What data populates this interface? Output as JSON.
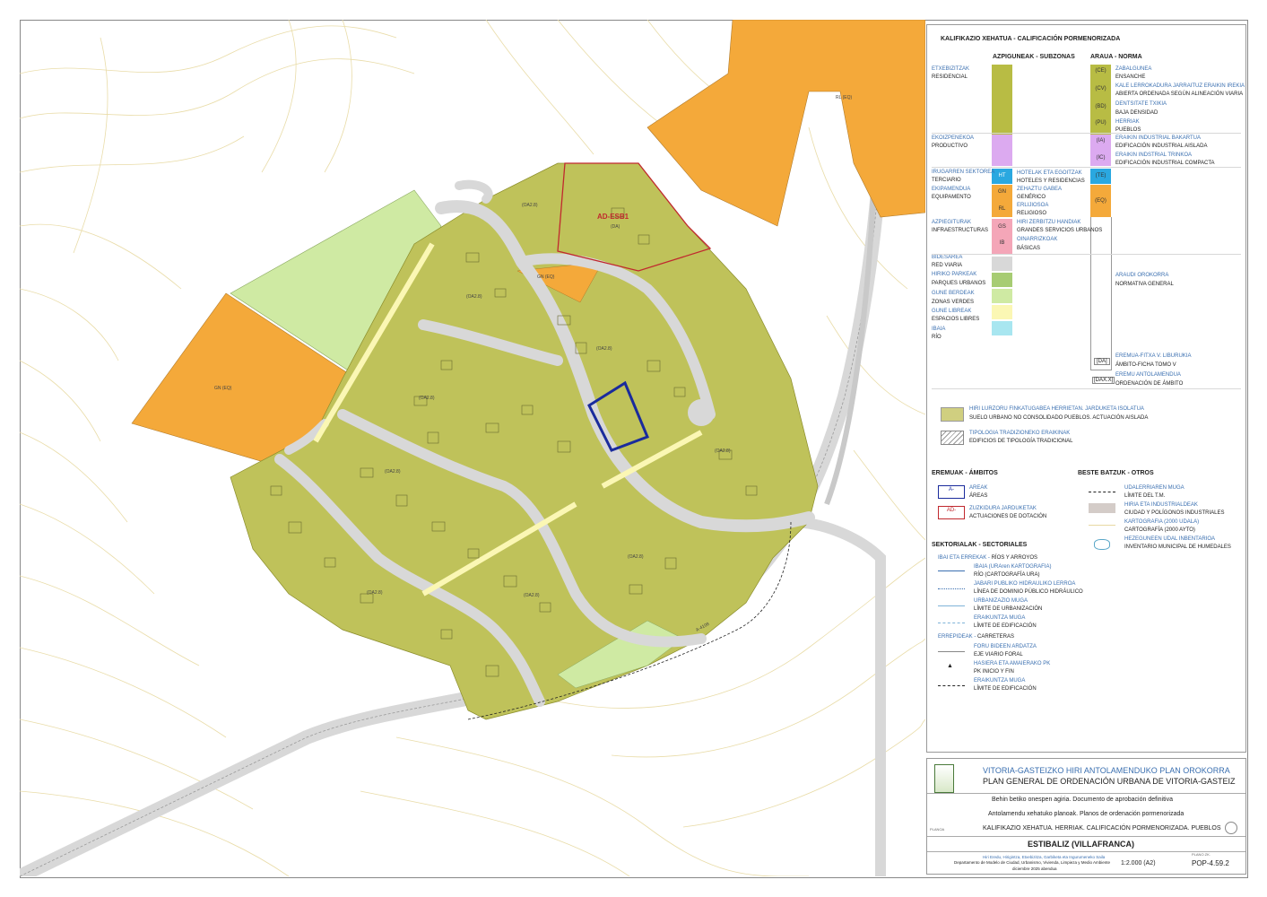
{
  "legend": {
    "title_eu": "KALIFIKAZIO XEHATUA - ",
    "title_es": "CALIFICACIÓN PORMENORIZADA",
    "col_subzones_eu": "AZPIGUNEAK - ",
    "col_subzones_es": "SUBZONAS",
    "col_norm_eu": "ARAUA - ",
    "col_norm_es": "NORMA",
    "residential_eu": "ETXEBIZITZAK",
    "residential_es": "RESIDENCIAL",
    "ce_eu": "ZABALGUNEA",
    "ce_es": "ENSANCHE",
    "cv_eu": "KALE LERROKADURA JARRAITUZ ERAIKIN IREKIA",
    "cv_es": "ABIERTA ORDENADA SEGÚN ALINEACIÓN VIARIA",
    "bd_eu": "DENTSITATE TXIKIA",
    "bd_es": "BAJA DENSIDAD",
    "pu_eu": "HERRIAK",
    "pu_es": "PUEBLOS",
    "productive_eu": "EKOIZPENEKOA",
    "productive_es": "PRODUCTIVO",
    "ia_eu": "ERAIKIN INDUSTRIAL BAKARTUA",
    "ia_es": "EDIFICACIÓN INDUSTRIAL AISLADA",
    "ic_eu": "ERAIKIN INDSTRIAL TRINKOA",
    "ic_es": "EDIFICACIÓN INDUSTRIAL COMPACTA",
    "tertiary_eu": "IRUGARREN SEKTOREA",
    "tertiary_es": "TERCIARIO",
    "ht_eu": "HOTELAK ETA EGOITZAK",
    "ht_es": "HOTELES Y RESIDENCIAS",
    "equip_eu": "EKIPAMENDUA",
    "equip_es": "EQUIPAMENTO",
    "gn_eu": "ZEHAZTU GABEA",
    "gn_es": "GENÉRICO",
    "rl_eu": "ERLIJIOSOA",
    "rl_es": "RELIGIOSO",
    "infra_eu": "AZPIEGITURAK",
    "infra_es": "INFRAESTRUCTURAS",
    "gs_eu": "HIRI ZERBITZU HANDIAK",
    "gs_es": "GRANDES SERVICIOS URBANOS",
    "ib_eu": "OINARRIZKOAK",
    "ib_es": "BÁSICAS",
    "road_eu": "BIDESAREA",
    "road_es": "RED VIARIA",
    "parks_eu": "HIRIKO PARKEAK",
    "parks_es": "PARQUES URBANOS",
    "green_eu": "GUNE BERDEAK",
    "green_es": "ZONAS VERDES",
    "free_eu": "GUNE LIBREAK",
    "free_es": "ESPACIOS LIBRES",
    "river_eu": "IBAIA",
    "river_es": "RÍO",
    "general_norm_eu": "ARAUDI OROKORRA",
    "general_norm_es": "NORMATIVA GENERAL",
    "da_eu": "EREMUA-FITXA V. LIBURUKIA",
    "da_es": "ÁMBITO-FICHA TOMO V",
    "dax_eu": "EREMU ANTOLAMENDUA",
    "dax_es": "ORDENACIÓN DE ÁMBITO",
    "unconsolidated_eu": "HIRI LURZORU FINKATUGABEA HERRIETAN. JARDUKETA ISOLATUA",
    "unconsolidated_es": "SUELO URBANO NO CONSOLIDADO PUEBLOS. ACTUACIÓN AISLADA",
    "traditional_eu": "TIPOLOGIA TRADIZIONEKO ERAIKINAK",
    "traditional_es": "EDIFICIOS DE TIPOLOGÍA TRADICIONAL",
    "scopes_eu": "EREMUAK - ",
    "scopes_es": "ÁMBITOS",
    "areas_eu": "AREAK",
    "areas_es": "ÁREAS",
    "endowment_eu": "ZUZKIDURA JARDUKETAK",
    "endowment_es": "ACTUACIONES DE DOTACIÓN",
    "others_eu": "BESTE BATZUK - ",
    "others_es": "OTROS",
    "muni_eu": "UDALERRIAREN MUGA",
    "muni_es": "LÍMITE DEL T.M.",
    "industrial_eu": "HIRIA ETA INDUSTRIALDEAK",
    "industrial_es": "CIUDAD Y POLÍGONOS INDUSTRIALES",
    "carto_eu": "KARTOGRAFIA (2000 UDALA)",
    "carto_es": "CARTOGRAFÍA (2000 AYTO)",
    "wetlands_eu": "HEZEGUNEEN UDAL INBENTARIOA",
    "wetlands_es": "INVENTARIO MUNICIPAL DE HUMEDALES",
    "sectoral_eu": "SEKTORIALAK - ",
    "sectoral_es": "SECTORIALES",
    "rivers_eu": "IBAI ETA ERREKAK - ",
    "rivers_es": "RÍOS Y ARROYOS",
    "ura_eu": "IBAIA (URAren KARTOGRAFIA)",
    "ura_es": "RÍO (CARTOGRAFÍA URA)",
    "hydro_eu": "JABARI PUBLIKO HIDRAULIKO LERROA",
    "hydro_es": "LÍNEA DE DOMINIO PÚBLICO HIDRÁULICO",
    "urb_eu": "URBANIZAZIO MUGA",
    "urb_es": "LÍMITE DE URBANIZACIÓN",
    "build_eu": "ERAIKUNTZA MUGA",
    "build_es": "LÍMITE DE EDIFICACIÓN",
    "roads_eu": "ERREPIDEAK - ",
    "roads_es": "CARRETERAS",
    "foral_eu": "FORU BIDEEN ARDATZA",
    "foral_es": "EJE VIARIO FORAL",
    "pk_eu": "HASIERA ETA AMAIERAKO PK",
    "pk_es": "PK INICIO Y FIN",
    "build2_eu": "ERAIKUNTZA MUGA",
    "build2_es": "LÍMITE DE EDIFICACIÓN"
  },
  "codes": [
    "(CE)",
    "(CV)",
    "(BD)",
    "(PU)",
    "(IA)",
    "(IC)",
    "(TE)",
    "(EQ)"
  ],
  "side_codes": [
    "HT",
    "GN",
    "RL",
    "GS",
    "IB"
  ],
  "da_code": "[DA]",
  "dax_code": "[DAX.X]",
  "area_code": "A-",
  "ad_code": "AD-",
  "map": {
    "ad_label": "AD-ESB1",
    "ad_sub": "(DA)",
    "labels": [
      "(OA2.8)",
      "(OA2.8)",
      "(OA2.8)",
      "(OA2.8)",
      "(OA2.8)",
      "(OA2.8)",
      "(OA2.8)",
      "(OA2.8)",
      "(OA2.8)",
      "(OA2.8)"
    ],
    "gn_eq": "GN (EQ)",
    "gn_eq2": "GN (EQ)",
    "rl_eq": "RL (EQ)",
    "road_name": "A-4108"
  },
  "titleblock": {
    "title_eu": "VITORIA-GASTEIZKO HIRI ANTOLAMENDUKO PLAN OROKORRA",
    "title_es": "PLAN GENERAL DE ORDENACIÓN URBANA DE VITORIA-GASTEIZ",
    "approval": "Behin betiko onespen agiria. Documento de aprobación definitiva",
    "plans": "Antolamendu xehatuko planoak. Planos de ordenación pormenorizada",
    "plano_label": "PLANOA",
    "subject": "KALIFIKAZIO XEHATUA. HERRIAK. CALIFICACIÓN PORMENORIZADA. PUEBLOS",
    "place": "ESTIBALIZ (VILLAFRANCA)",
    "dept_eu": "Hiri Eredu, Hirigintza, Etxebizitza, Garbiketa eta Ingurumeneko Saila",
    "dept_es": "Departamento de Modelo de Ciudad, Urbanismo, Vivienda, Limpieza y Medio Ambiente",
    "date": "diciembre 2025 abendua",
    "scale": "1:2.000 (A2)",
    "num_label": "PLANO ZK.",
    "number": "POP-4.59.2"
  },
  "colors": {
    "residential": "#b8bc44",
    "residential_fill": "#bfc25a",
    "productive": "#dcaaf0",
    "tertiary": "#2aa8e0",
    "equipment": "#f4a93a",
    "infra": "#f4a6b8",
    "road": "#d8d8d8",
    "parks": "#a7cc73",
    "green": "#cfeaa3",
    "free": "#fbf7b4",
    "river": "#a8e6f0",
    "area_outline": "#1a2b9c",
    "ad_outline": "#c0282e",
    "contour": "#e8d9a3"
  }
}
